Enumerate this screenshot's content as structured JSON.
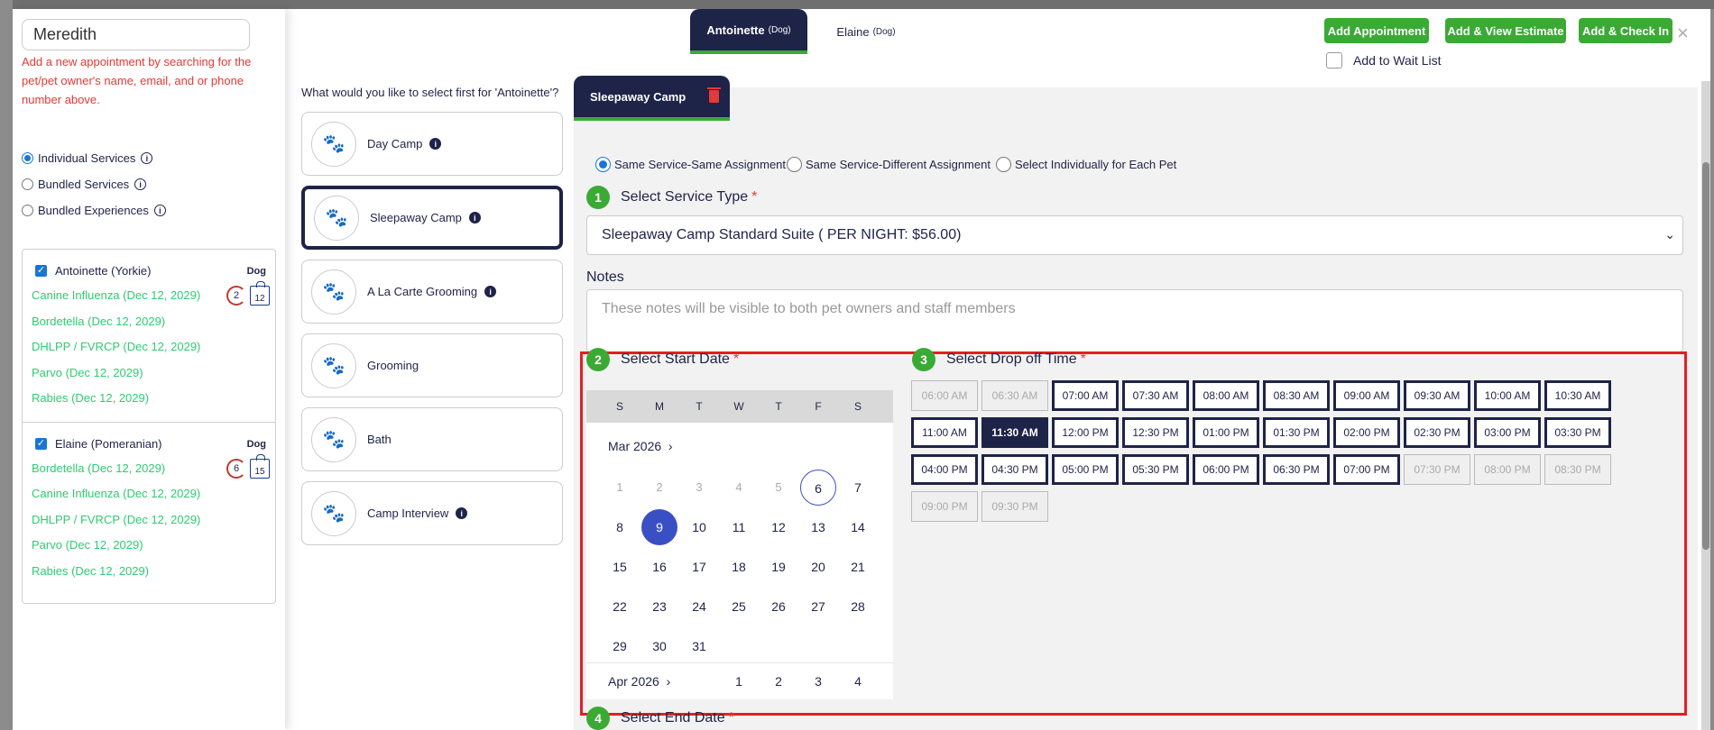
{
  "search": {
    "value": "Meredith",
    "hint": "Add a new appointment by searching for the pet/pet owner's name, email, and or phone number above."
  },
  "service_categories": [
    {
      "label": "Individual Services",
      "checked": true
    },
    {
      "label": "Bundled Services",
      "checked": false
    },
    {
      "label": "Bundled Experiences",
      "checked": false
    }
  ],
  "pets": [
    {
      "name": "Antoinette (Yorkie)",
      "species": "Dog",
      "badge_count": "2",
      "badge_weight": "12",
      "vaccines": [
        "Canine Influenza (Dec 12, 2029)",
        "Bordetella (Dec 12, 2029)",
        "DHLPP / FVRCP (Dec 12, 2029)",
        "Parvo (Dec 12, 2029)",
        "Rabies (Dec 12, 2029)"
      ]
    },
    {
      "name": "Elaine (Pomeranian)",
      "species": "Dog",
      "badge_count": "6",
      "badge_weight": "15",
      "vaccines": [
        "Bordetella (Dec 12, 2029)",
        "Canine Influenza (Dec 12, 2029)",
        "DHLPP / FVRCP (Dec 12, 2029)",
        "Parvo (Dec 12, 2029)",
        "Rabies (Dec 12, 2029)"
      ]
    }
  ],
  "pet_tabs": [
    {
      "name": "Antoinette",
      "species": "(Dog)"
    },
    {
      "name": "Elaine",
      "species": "(Dog)"
    }
  ],
  "actions": {
    "add_appointment": "Add Appointment",
    "add_view_estimate": "Add & View Estimate",
    "add_check_in": "Add & Check In",
    "wait_list": "Add to Wait List",
    "close": "×"
  },
  "service_prompt": "What would you like to select first for 'Antoinette'?",
  "services": [
    {
      "label": "Day Camp",
      "info": true
    },
    {
      "label": "Sleepaway Camp",
      "info": true,
      "selected": true
    },
    {
      "label": "A La Carte Grooming",
      "info": true
    },
    {
      "label": "Grooming",
      "info": false
    },
    {
      "label": "Bath",
      "info": false
    },
    {
      "label": "Camp Interview",
      "info": true
    }
  ],
  "active_service_tab": "Sleepaway Camp",
  "assignment_options": [
    {
      "label": "Same Service-Same Assignment",
      "checked": true
    },
    {
      "label": "Same Service-Different Assignment",
      "checked": false
    },
    {
      "label": "Select Individually for Each Pet",
      "checked": false
    }
  ],
  "steps": {
    "s1": {
      "num": "1",
      "label": "Select Service Type"
    },
    "s2": {
      "num": "2",
      "label": "Select Start Date"
    },
    "s3": {
      "num": "3",
      "label": "Select Drop off Time"
    },
    "s4": {
      "num": "4",
      "label": "Select End Date"
    },
    "required_mark": "*"
  },
  "service_type_value": "Sleepaway Camp Standard Suite ( PER NIGHT: $56.00)",
  "notes": {
    "label": "Notes",
    "placeholder": "These notes will be visible to both pet owners and staff members"
  },
  "calendar": {
    "weekdays": [
      "S",
      "M",
      "T",
      "W",
      "T",
      "F",
      "S"
    ],
    "month": "Mar 2026",
    "next_month": "Apr 2026",
    "rows": [
      [
        "1",
        "2",
        "3",
        "4",
        "5",
        "6",
        "7"
      ],
      [
        "8",
        "9",
        "10",
        "11",
        "12",
        "13",
        "14"
      ],
      [
        "15",
        "16",
        "17",
        "18",
        "19",
        "20",
        "21"
      ],
      [
        "22",
        "23",
        "24",
        "25",
        "26",
        "27",
        "28"
      ],
      [
        "29",
        "30",
        "31",
        "",
        "",
        "",
        ""
      ]
    ],
    "past_days": [
      "1",
      "2",
      "3",
      "4",
      "5"
    ],
    "today": "6",
    "selected": "9",
    "next_month_days": [
      "1",
      "2",
      "3",
      "4"
    ]
  },
  "time_slots": [
    [
      "06:00 AM",
      "06:30 AM",
      "07:00 AM",
      "07:30 AM",
      "08:00 AM",
      "08:30 AM",
      "09:00 AM",
      "09:30 AM",
      "10:00 AM",
      "10:30 AM"
    ],
    [
      "11:00 AM",
      "11:30 AM",
      "12:00 PM",
      "12:30 PM",
      "01:00 PM",
      "01:30 PM",
      "02:00 PM",
      "02:30 PM",
      "03:00 PM",
      "03:30 PM"
    ],
    [
      "04:00 PM",
      "04:30 PM",
      "05:00 PM",
      "05:30 PM",
      "06:00 PM",
      "06:30 PM",
      "07:00 PM",
      "07:30 PM",
      "08:00 PM",
      "08:30 PM"
    ],
    [
      "09:00 PM",
      "09:30 PM"
    ]
  ],
  "disabled_slots": [
    "06:00 AM",
    "06:30 AM",
    "07:30 PM",
    "08:00 PM",
    "08:30 PM",
    "09:00 PM",
    "09:30 PM"
  ],
  "selected_slot": "11:30 AM",
  "colors": {
    "navy": "#1e2348",
    "green": "#3aaa35",
    "red": "#e31e24",
    "vaccine_green": "#2ecc71",
    "selected_date": "#3b4fc4"
  }
}
